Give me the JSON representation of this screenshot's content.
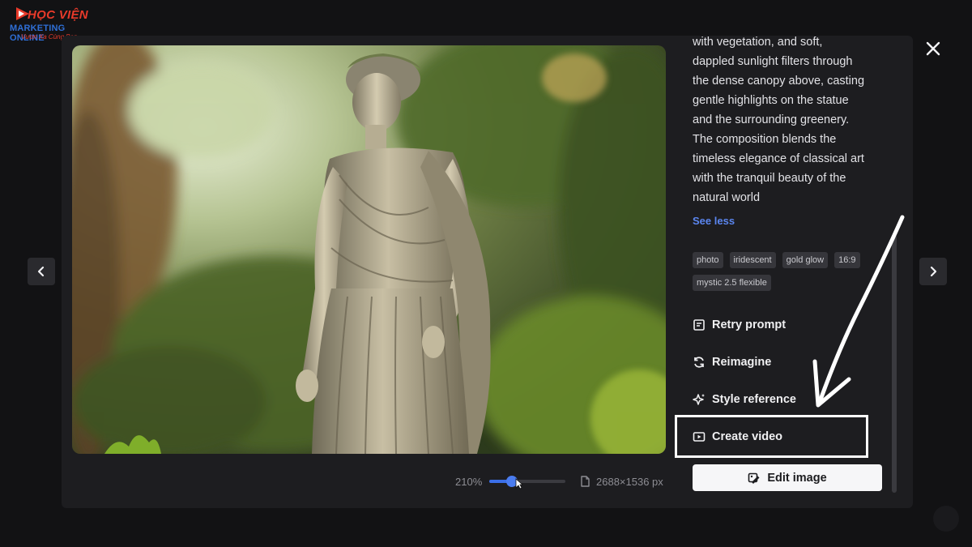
{
  "logo": {
    "line1": "HỌC VIỆN",
    "line2": "MARKETING ONLINE",
    "line3": "Vươn Xa Cùng Bạn",
    "brand_red": "#e83a2a",
    "brand_blue": "#2f6fd6"
  },
  "viewer": {
    "zoom_label": "210%",
    "zoom_value": 0.3,
    "dimensions": "2688×1536 px",
    "description_lines": [
      "with vegetation, and soft,",
      "dappled sunlight filters through",
      "the dense canopy above, casting",
      "gentle highlights on the statue",
      "and the surrounding greenery.",
      "The composition blends the",
      "timeless elegance of classical art",
      "with the tranquil beauty of the",
      "natural world"
    ],
    "see_less": "See less",
    "tags": [
      "photo",
      "iridescent",
      "gold glow",
      "16:9",
      "mystic 2.5 flexible"
    ],
    "actions": {
      "retry": "Retry prompt",
      "reimagine": "Reimagine",
      "style": "Style reference",
      "video": "Create video"
    },
    "edit_label": "Edit image",
    "accent": "#3b6fe8"
  }
}
